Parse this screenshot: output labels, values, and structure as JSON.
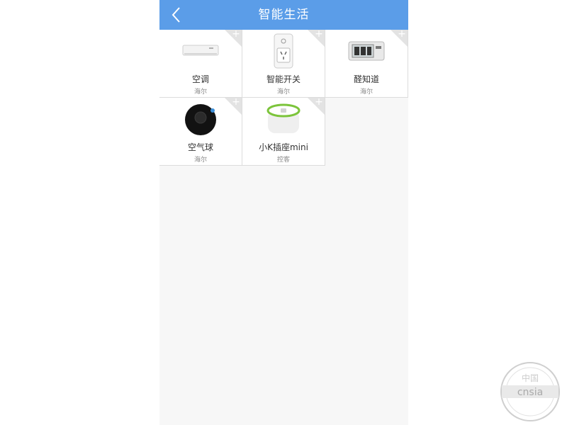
{
  "header": {
    "title": "智能生活"
  },
  "devices": [
    {
      "name": "空调",
      "brand": "海尔"
    },
    {
      "name": "智能开关",
      "brand": "海尔"
    },
    {
      "name": "醛知道",
      "brand": "海尔"
    },
    {
      "name": "空气球",
      "brand": "海尔"
    },
    {
      "name": "小K插座mini",
      "brand": "控客"
    }
  ],
  "accent": "#5b9de8"
}
